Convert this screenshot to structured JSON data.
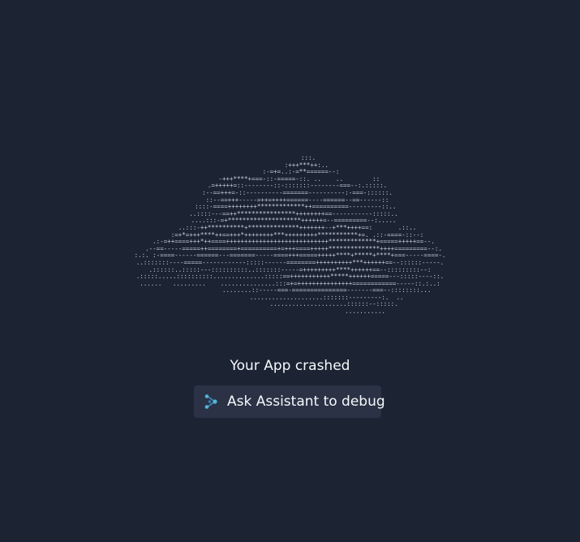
{
  "crash": {
    "title": "Your App crashed",
    "ascii_art": "          :::.\n         :+++***++:..\n      :-=+=..:-=**======--:\n     -+++****+===-::-=====-::. ..    ..        ::\n    .=+++++=::--------::-:::::::--------===--:.:::::.\n    :--==+++=-::----------=======----------:-===-::::::.\n    ::--==+++-----=++=++++======----======--==------::\n   ::::-====++++++++*************++==========---------::..\n  ..::::---==++****************++++++++==-----------:::::..\n  ....:::-=+********************++++++=--=========--:.....\n    ..:::-++**********+**************+++++++--+***++++==:       .::..\n    :=+*=+++****++==+++*++++++++***+++++++++***********+=. .::-====-::--:\n  .:-=++====+++*++====++++++++++++++++++++++++++++*************+=====+++++==--.\n  .--==-----=====++========+==========+=+++====+++++**************++++=========--:.\n:.:. :-====------======---=======-----====+++=====+++++****+*****+****+===-----====-.\n..:::::::----=====------------:::::------========++++++++++***++++++==--::::::-----.\n.::::::..:::::---::::::::::..:::::::-----=+++++++++****++++++==--:::::::::--:\n.:::::.....::::::::::..............:::::==+++++++++++*****++++++=====---:::::----::.\n......   .........    ...............:::=+=+++++++++++++++============-----::.:..:\n                    ........::-----===-===============-------===--::::::::...\n                    ....................:::::::---------:.  ..\n                        .....................::::::--:::::.\n                                         ..........."
  },
  "assistant_button": {
    "label": "Ask Assistant to debug",
    "icon": "assistant-icon",
    "icon_color": "#56b3d8"
  }
}
